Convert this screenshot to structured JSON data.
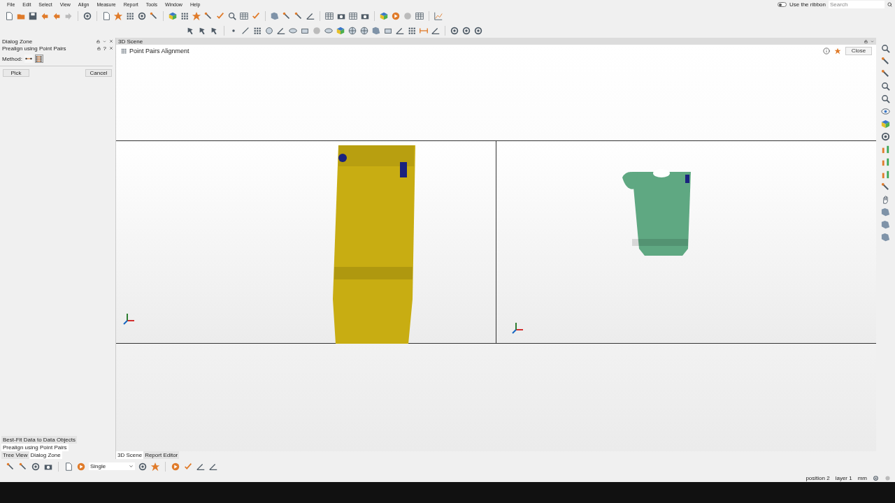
{
  "menu": [
    "File",
    "Edit",
    "Select",
    "View",
    "Align",
    "Measure",
    "Report",
    "Tools",
    "Window",
    "Help"
  ],
  "ribbon_toggle": {
    "label": "Use the ribbon",
    "on": false
  },
  "search": {
    "placeholder": "Search"
  },
  "dialog_zone": {
    "title": "Dialog Zone",
    "panel_title": "Prealign using Point Pairs",
    "help_mark": "?",
    "method_label": "Method:",
    "methods": [
      {
        "kind": "pairs",
        "selected": false
      },
      {
        "kind": "grid",
        "selected": true
      }
    ],
    "buttons": [
      "Pick",
      "Cancel"
    ]
  },
  "left_tabs": [
    {
      "label": "Best-Fit Data to Data Objects",
      "selected": false
    },
    {
      "label": "Prealign using Point Pairs",
      "selected": true
    }
  ],
  "left_view_tabs": [
    {
      "label": "Tree View",
      "selected": false
    },
    {
      "label": "Dialog Zone",
      "selected": true
    }
  ],
  "scene": {
    "title": "3D Scene",
    "heading": "Point Pairs Alignment",
    "close": "Close",
    "viewports": [
      {
        "color": "#c8ad12"
      },
      {
        "color": "#5fa882"
      }
    ]
  },
  "scene_tabs": [
    {
      "label": "3D Scene",
      "selected": true
    },
    {
      "label": "Report Editor",
      "selected": false
    }
  ],
  "bottom_toolbar": {
    "mode": "Single"
  },
  "status_bar": [
    "position 2",
    "layer 1",
    "mm"
  ]
}
